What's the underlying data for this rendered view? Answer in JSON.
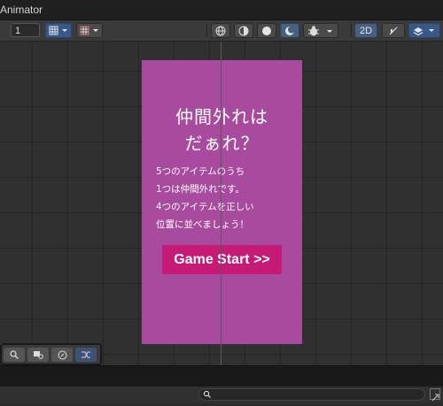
{
  "window": {
    "title": "Animator"
  },
  "toolbar": {
    "frame_value": "1",
    "toggle_2d_label": "2D"
  },
  "game": {
    "heading_line1": "仲間外れは",
    "heading_line2": "だぁれ？",
    "body": [
      "5つのアイテムのうち",
      "1つは仲間外れです。",
      "4つのアイテムを正しい",
      "位置に並べましょう！"
    ],
    "start_button": "Game Start >>"
  },
  "colors": {
    "panel_bg": "#a84b9e",
    "button_bg": "#c51b77",
    "toolbar_blue": "#36598a"
  },
  "icons": [
    "grid-icon",
    "snap-icon",
    "globe-icon",
    "light-icon",
    "circle-icon",
    "moon-icon",
    "bug-icon",
    "audio-icon",
    "layers-icon",
    "search-icon",
    "camera-icon",
    "compass-icon",
    "shuffle-icon",
    "search-icon",
    "expand-icon"
  ]
}
